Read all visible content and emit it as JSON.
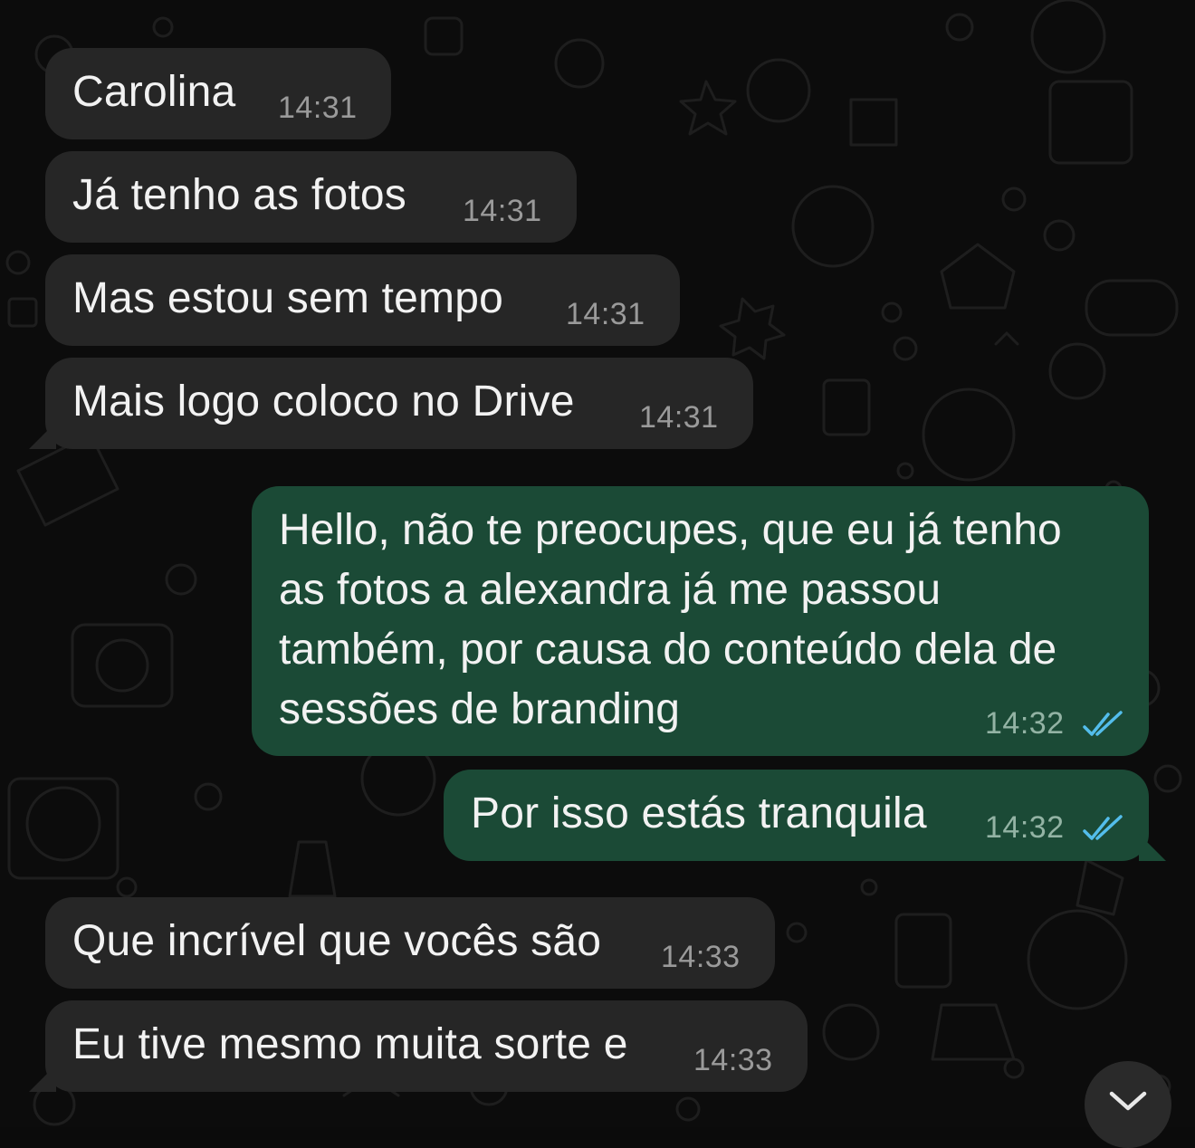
{
  "messages": [
    {
      "direction": "incoming",
      "text": "Carolina",
      "time": "14:31"
    },
    {
      "direction": "incoming",
      "text": "Já tenho as fotos",
      "time": "14:31"
    },
    {
      "direction": "incoming",
      "text": "Mas estou sem tempo",
      "time": "14:31"
    },
    {
      "direction": "incoming",
      "text": "Mais logo coloco no Drive",
      "time": "14:31"
    },
    {
      "direction": "outgoing",
      "lines": [
        "Hello, não te preocupes, que eu já tenho",
        "as fotos a alexandra já me passou",
        "também, por causa do conteúdo dela de",
        "sessões de branding"
      ],
      "time": "14:32",
      "status": "read"
    },
    {
      "direction": "outgoing",
      "text": "Por isso estás tranquila",
      "time": "14:32",
      "status": "read"
    },
    {
      "direction": "incoming",
      "text": "Que incrível que vocês são",
      "time": "14:33"
    },
    {
      "direction": "incoming",
      "text": "Eu tive mesmo muita sorte e",
      "time": "14:33"
    }
  ],
  "colors": {
    "incoming_bubble": "#262626",
    "outgoing_bubble": "#1b4a36",
    "read_ticks": "#53bdeb",
    "background": "#0c0c0c"
  },
  "icons": {
    "read_receipt": "double-check-icon",
    "scroll_down": "chevron-down-icon"
  }
}
